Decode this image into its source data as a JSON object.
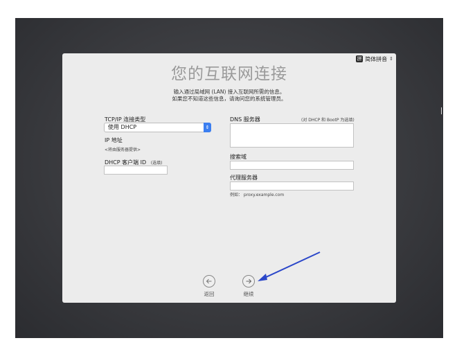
{
  "input_menu": {
    "icon_glyph": "拼",
    "label": "简体拼音",
    "icon": "chevron-updown-icon"
  },
  "title": "您的互联网连接",
  "subtitle_line1": "输入通过局域网 (LAN) 接入互联网所需的信息。",
  "subtitle_line2": "如果您不知道这些信息，请询问您的系统管理员。",
  "left": {
    "conn_type_label": "TCP/IP 连接类型",
    "conn_type_value": "使用 DHCP",
    "ip_label": "IP 地址",
    "ip_value": "<将由服务器提供>",
    "dhcp_client_label": "DHCP 客户端 ID",
    "dhcp_client_optional": "(选填)",
    "dhcp_client_value": ""
  },
  "right": {
    "dns_label": "DNS 服务器",
    "dns_note": "(对 DHCP 和 BootP 为选填)",
    "dns_value": "",
    "search_domain_label": "搜索域",
    "search_domain_value": "",
    "proxy_label": "代理服务器",
    "proxy_value": "",
    "proxy_example": "例如： proxy.example.com"
  },
  "nav": {
    "back_label": "返回",
    "continue_label": "继续"
  },
  "colors": {
    "accent": "#3b7ef0",
    "annotation_arrow": "#2b47c9",
    "panel": "#ececec",
    "desktop": "#3a3b3f"
  }
}
